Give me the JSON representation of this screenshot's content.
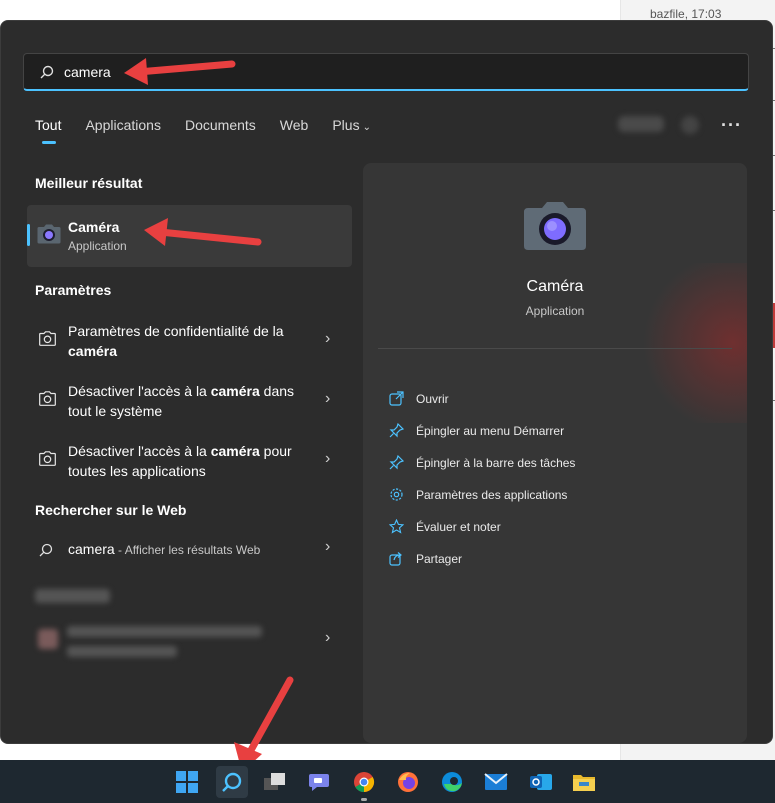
{
  "background": {
    "top_text": "bazfile, 17:03"
  },
  "search": {
    "value": "camera",
    "placeholder": ""
  },
  "tabs": [
    {
      "label": "Tout",
      "active": true
    },
    {
      "label": "Applications"
    },
    {
      "label": "Documents"
    },
    {
      "label": "Web"
    },
    {
      "label": "Plus",
      "icon": "chevron-down-icon"
    }
  ],
  "best_match": {
    "heading": "Meilleur résultat",
    "name": "Caméra",
    "type": "Application",
    "icon": "camera-app-icon"
  },
  "settings": {
    "heading": "Paramètres",
    "items": [
      {
        "pre": "Paramètres de confidentialité de la ",
        "bold": "caméra",
        "post": "",
        "icon": "camera-outline-icon"
      },
      {
        "pre": "Désactiver l'accès à la ",
        "bold": "caméra",
        "post": " dans tout le système",
        "icon": "camera-outline-icon"
      },
      {
        "pre": "Désactiver l'accès à la ",
        "bold": "caméra",
        "post": " pour toutes les applications",
        "icon": "camera-outline-icon"
      }
    ]
  },
  "web": {
    "heading": "Rechercher sur le Web",
    "query": "camera",
    "suffix": " - Afficher les résultats Web"
  },
  "details": {
    "name": "Caméra",
    "type": "Application",
    "actions": [
      {
        "label": "Ouvrir",
        "icon": "open-external-icon"
      },
      {
        "label": "Épingler au menu Démarrer",
        "icon": "pin-icon"
      },
      {
        "label": "Épingler à la barre des tâches",
        "icon": "pin-icon"
      },
      {
        "label": "Paramètres des applications",
        "icon": "gear-icon"
      },
      {
        "label": "Évaluer et noter",
        "icon": "star-icon"
      },
      {
        "label": "Partager",
        "icon": "share-icon"
      }
    ]
  },
  "taskbar": {
    "items": [
      "windows-start-icon",
      "search-icon",
      "task-view-icon",
      "teams-chat-icon",
      "chrome-icon",
      "firefox-icon",
      "edge-icon",
      "mail-icon",
      "outlook-icon",
      "file-explorer-icon"
    ]
  },
  "colors": {
    "accent": "#4cc2ff",
    "panel": "#2c2c2c",
    "annotation_arrow": "#e84040"
  }
}
